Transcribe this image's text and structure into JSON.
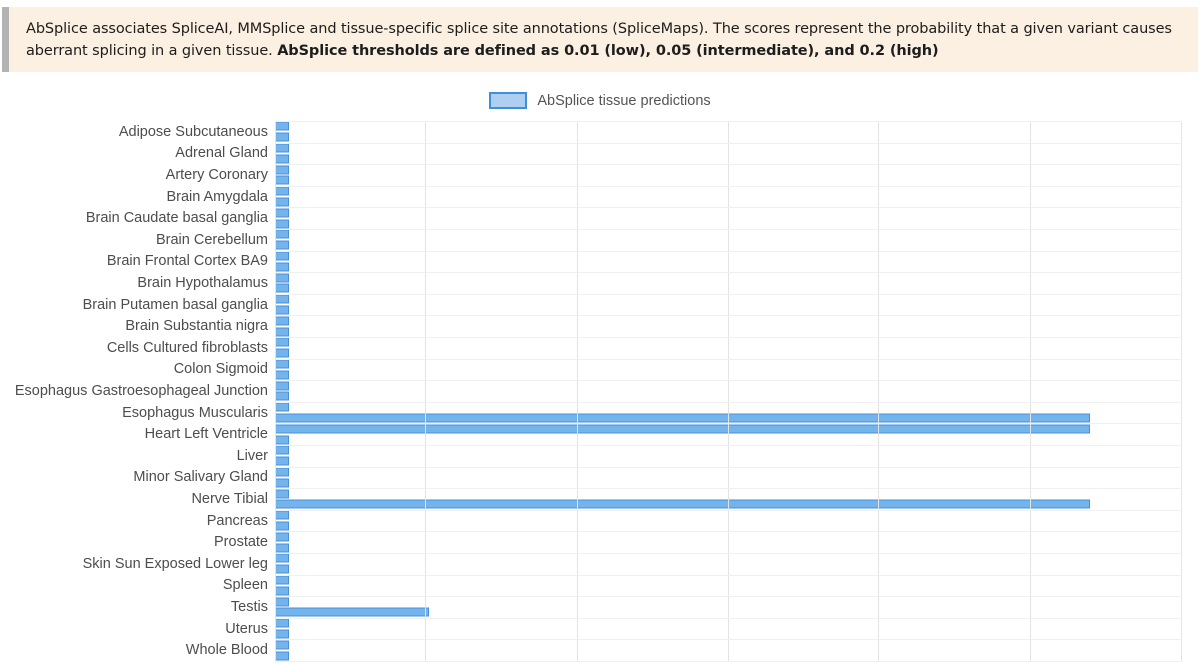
{
  "banner": {
    "text_part1": "AbSplice associates SpliceAI, MMSplice and tissue-specific splice site annotations (SpliceMaps). The scores represent the probability that a given variant causes aberrant splicing in a given tissue. ",
    "text_bold": "AbSplice thresholds are defined as 0.01 (low), 0.05 (intermediate), and 0.2 (high)"
  },
  "legend": {
    "label": "AbSplice tissue predictions",
    "swatch_fill": "#aecfef",
    "swatch_stroke": "#3f8fdd"
  },
  "chart_data": {
    "type": "bar",
    "orientation": "horizontal",
    "title": "",
    "xlabel": "",
    "ylabel": "",
    "grid": true,
    "legend_position": "top-center",
    "bar_fill": "#74b4ec",
    "bar_stroke": "#4a90d9",
    "xlim": [
      0,
      1.0
    ],
    "xticks": [
      0,
      0.166,
      0.333,
      0.5,
      0.666,
      0.833,
      1.0
    ],
    "categories": [
      "Adipose Subcutaneous",
      "Adrenal Gland",
      "Artery Coronary",
      "Brain Amygdala",
      "Brain Caudate basal ganglia",
      "Brain Cerebellum",
      "Brain Frontal Cortex BA9",
      "Brain Hypothalamus",
      "Brain Putamen basal ganglia",
      "Brain Substantia nigra",
      "Cells Cultured fibroblasts",
      "Colon Sigmoid",
      "Esophagus Gastroesophageal Junction",
      "Esophagus Muscularis",
      "Heart Left Ventricle",
      "Liver",
      "Minor Salivary Gland",
      "Nerve Tibial",
      "Pancreas",
      "Prostate",
      "Skin Sun Exposed Lower leg",
      "Spleen",
      "Testis",
      "Uterus",
      "Whole Blood"
    ],
    "series": [
      {
        "name": "AbSplice tissue predictions",
        "values": [
          0.016,
          0.016,
          0.016,
          0.016,
          0.016,
          0.016,
          0.016,
          0.016,
          0.016,
          0.016,
          0.016,
          0.016,
          0.016,
          0.016,
          0.016,
          0.016,
          0.016,
          0.016,
          0.016,
          0.016,
          0.016,
          0.016,
          0.016,
          0.016,
          0.016,
          0.016,
          0.016,
          0.9,
          0.9,
          0.016,
          0.016,
          0.016,
          0.016,
          0.016,
          0.016,
          0.9,
          0.016,
          0.016,
          0.016,
          0.016,
          0.016,
          0.016,
          0.016,
          0.016,
          0.016,
          0.17,
          0.016,
          0.016,
          0.016,
          0.016
        ]
      }
    ]
  }
}
